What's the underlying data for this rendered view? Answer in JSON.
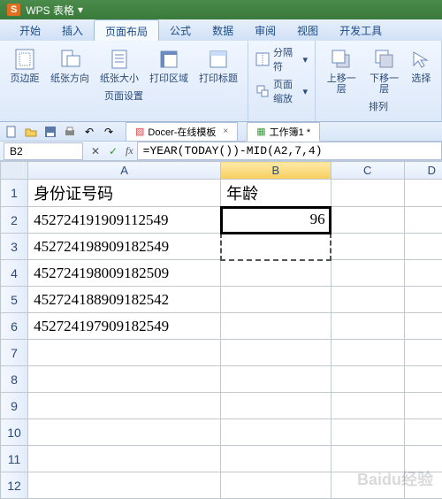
{
  "title": {
    "logo": "S",
    "app": "WPS 表格"
  },
  "menu": {
    "items": [
      "开始",
      "插入",
      "页面布局",
      "公式",
      "数据",
      "审阅",
      "视图",
      "开发工具"
    ],
    "active_index": 2
  },
  "ribbon": {
    "page_setup": {
      "margins": "页边距",
      "orientation": "纸张方向",
      "size": "纸张大小",
      "print_area": "打印区域",
      "print_titles": "打印标题",
      "label": "页面设置"
    },
    "breaks": "分隔符",
    "scale": "页面缩放",
    "arrange": {
      "bring_fwd": "上移一层",
      "send_back": "下移一层",
      "selection": "选择",
      "label": "排列"
    }
  },
  "qat": {
    "doc_templates": "Docer-在线模板",
    "workbook": "工作簿1 *"
  },
  "formula_bar": {
    "cell_ref": "B2",
    "formula": "=YEAR(TODAY())-MID(A2,7,4)"
  },
  "columns": [
    "A",
    "B",
    "C",
    "D"
  ],
  "rows_count": 12,
  "headers": {
    "A": "身份证号码",
    "B": "年龄"
  },
  "data": {
    "A": [
      "452724191909112549",
      "452724198909182549",
      "452724198009182509",
      "452724188909182542",
      "452724197909182549"
    ],
    "B2": "96"
  },
  "active_cell": "B2",
  "watermark": "Baidu经验"
}
